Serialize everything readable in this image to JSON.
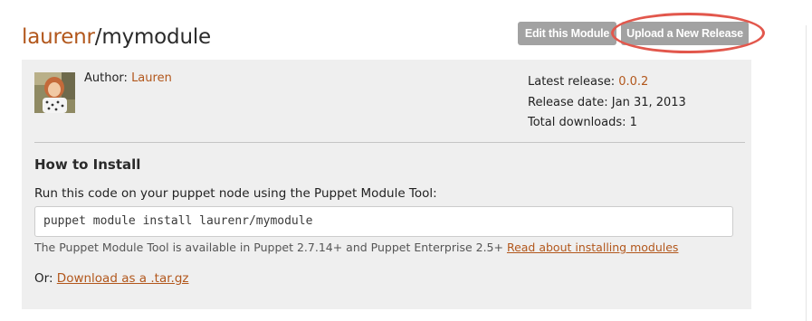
{
  "header": {
    "owner": "laurenr",
    "separator": "/",
    "module_name": "mymodule",
    "edit_button": "Edit this Module",
    "upload_button": "Upload a New Release"
  },
  "author": {
    "label": "Author:",
    "name": "Lauren"
  },
  "release": {
    "latest_label": "Latest release:",
    "latest_value": "0.0.2",
    "date_label": "Release date:",
    "date_value": "Jan 31, 2013",
    "downloads_label": "Total downloads:",
    "downloads_value": "1"
  },
  "install": {
    "heading": "How to Install",
    "instruction": "Run this code on your puppet node using the Puppet Module Tool:",
    "command": "puppet module install laurenr/mymodule",
    "availability_note": "The Puppet Module Tool is available in Puppet 2.7.14+ and Puppet Enterprise 2.5+",
    "read_link": "Read about installing modules",
    "or_label": "Or:",
    "download_link": "Download as a .tar.gz"
  },
  "colors": {
    "accent": "#b2571c",
    "button_bg": "#a2a2a2",
    "highlight": "#e2574c",
    "panel_bg": "#efefef"
  }
}
